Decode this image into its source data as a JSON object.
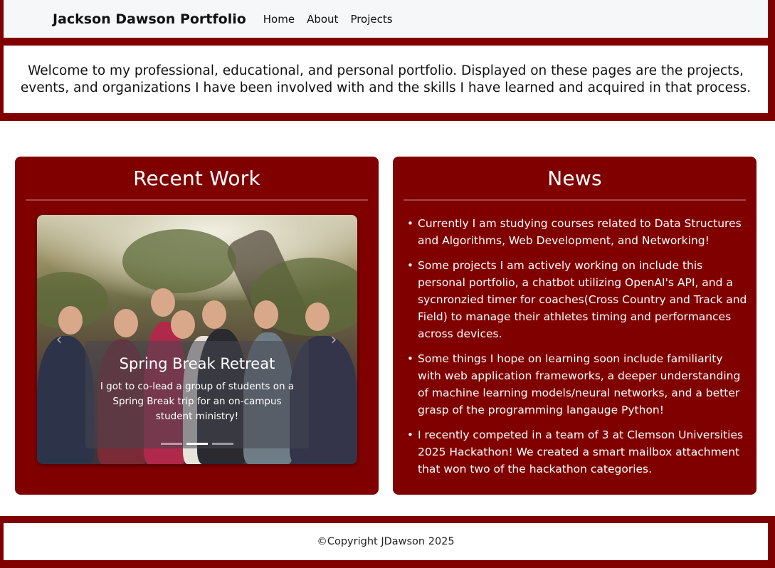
{
  "navbar": {
    "brand": "Jackson Dawson Portfolio",
    "links": [
      "Home",
      "About",
      "Projects"
    ]
  },
  "intro": {
    "text": "Welcome to my professional, educational, and personal portfolio. Displayed on these pages are the projects, events, and organizations I have been involved with and the skills I have learned and acquired in that process."
  },
  "recent_work": {
    "title": "Recent Work",
    "slide": {
      "title": "Spring Break Retreat",
      "text": "I got to co-lead a group of students on a Spring Break trip for an on-campus student ministry!"
    },
    "indicator_count": 3,
    "active_indicator": 2
  },
  "news": {
    "title": "News",
    "items": [
      "Currently I am studying courses related to Data Structures and Algorithms, Web Development, and Networking!",
      "Some projects I am actively working on include this personal portfolio, a chatbot utilizing OpenAI's API, and a sycnronzied timer for coaches(Cross Country and Track and Field) to manage their athletes timing and performances across devices.",
      "Some things I hope on learning soon include familiarity with web application frameworks, a deeper understanding of machine learning models/neural networks, and a better grasp of the programming langauge Python!",
      "I recently competed in a team of 3 at Clemson Universities 2025 Hackathon! We created a smart mailbox attachment that won two of the hackathon categories."
    ]
  },
  "footer": {
    "text": "©Copyright JDawson 2025"
  },
  "colors": {
    "accent": "#800000",
    "navbar_bg": "#f6f7f9"
  }
}
